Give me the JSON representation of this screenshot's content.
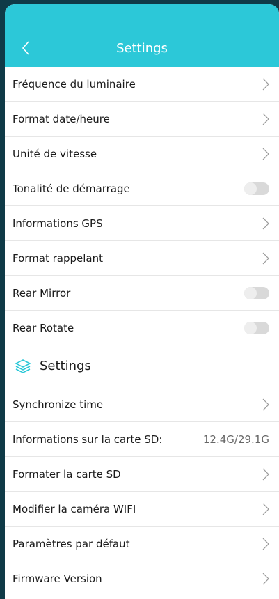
{
  "header": {
    "title": "Settings"
  },
  "rows1": [
    {
      "label": "Fréquence du luminaire"
    },
    {
      "label": "Format date/heure"
    },
    {
      "label": "Unité de vitesse"
    },
    {
      "label": "Tonalité de démarrage"
    },
    {
      "label": "Informations GPS"
    },
    {
      "label": "Format rappelant"
    },
    {
      "label": "Rear Mirror"
    },
    {
      "label": "Rear Rotate"
    }
  ],
  "section": {
    "title": "Settings",
    "icon": "layers-icon"
  },
  "rows2": [
    {
      "label": "Synchronize time"
    },
    {
      "label": "Informations sur la carte SD:",
      "value": "12.4G/29.1G"
    },
    {
      "label": "Formater la carte SD"
    },
    {
      "label": "Modifier la caméra WIFI"
    },
    {
      "label": "Paramètres par défaut"
    },
    {
      "label": "Firmware Version"
    }
  ],
  "colors": {
    "accent": "#2cc8d8",
    "background": "#0f3a47"
  }
}
